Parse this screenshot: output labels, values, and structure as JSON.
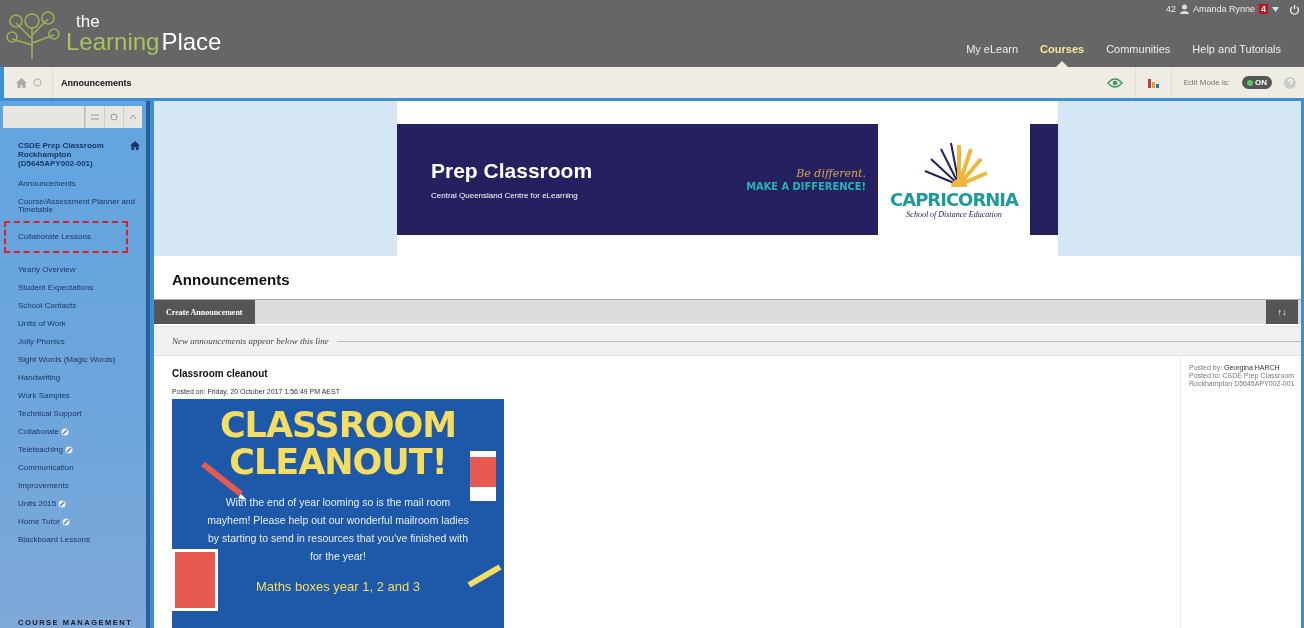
{
  "header": {
    "logo_small": "the",
    "logo_word_1": "Learning",
    "logo_word_2": "Place",
    "user": {
      "count": "42",
      "name": "Amanda Rynne",
      "badge": "4"
    },
    "nav": [
      {
        "label": "My eLearn",
        "selected": false
      },
      {
        "label": "Courses",
        "selected": true
      },
      {
        "label": "Communities",
        "selected": false
      },
      {
        "label": "Help and Tutorials",
        "selected": false
      }
    ]
  },
  "breadcrumb": {
    "current": "Announcements",
    "edit_mode": {
      "label": "Edit Mode is:",
      "state": "ON",
      "on": true
    }
  },
  "sidebar": {
    "course_title": "CSDE Prep Classroom Rockhampton (D5645APY002-001)",
    "items": [
      {
        "label": "Announcements",
        "link_icon": false,
        "highlighted": false
      },
      {
        "label": "Course/Assessment Planner and Timetable",
        "link_icon": false,
        "highlighted": false
      },
      {
        "label": "Collaborate Lessons",
        "link_icon": false,
        "highlighted": true
      },
      {
        "label": "Yearly Overview",
        "link_icon": false,
        "highlighted": false
      },
      {
        "label": "Student Expectations",
        "link_icon": false,
        "highlighted": false
      },
      {
        "label": "School Contacts",
        "link_icon": false,
        "highlighted": false
      },
      {
        "label": "Units of Work",
        "link_icon": false,
        "highlighted": false
      },
      {
        "label": "Jolly Phonics",
        "link_icon": false,
        "highlighted": false
      },
      {
        "label": "Sight Words (Magic Words)",
        "link_icon": false,
        "highlighted": false
      },
      {
        "label": "Handwriting",
        "link_icon": false,
        "highlighted": false
      },
      {
        "label": "Work Samples",
        "link_icon": false,
        "highlighted": false
      },
      {
        "label": "Technical Support",
        "link_icon": false,
        "highlighted": false
      },
      {
        "label": "Collaborate",
        "link_icon": true,
        "highlighted": false
      },
      {
        "label": "Teleteaching",
        "link_icon": true,
        "highlighted": false
      },
      {
        "label": "Communication",
        "link_icon": false,
        "highlighted": false
      },
      {
        "label": "Improvements",
        "link_icon": false,
        "highlighted": false
      },
      {
        "label": "Units 2015",
        "link_icon": true,
        "highlighted": false
      },
      {
        "label": "Home Tutor",
        "link_icon": true,
        "highlighted": false
      },
      {
        "label": "Blackboard Lessons",
        "link_icon": false,
        "highlighted": false
      }
    ],
    "section": "COURSE MANAGEMENT"
  },
  "banner": {
    "title": "Prep Classroom",
    "subtitle": "Central Queensland Centre for eLearning",
    "slogan_1": "Be different.",
    "slogan_2": "MAKE A DIFFERENCE!",
    "school": "CAPRICORNIA",
    "school_tagline": "School of Distance Education"
  },
  "page_title": "Announcements",
  "actions": {
    "create": "Create Announcement",
    "sort": "↑↓"
  },
  "divider_note": "New announcements appear below this line",
  "announcement": {
    "title": "Classroom cleanout",
    "posted_on": "Posted on: Friday, 20 October 2017 1:56:49 PM AEST",
    "posted_by": "Posted by: **Georgina HARCH**",
    "posted_to": "Posted to: CSDE Prep Classroom Rockhampton D5645APY002-001",
    "flyer": {
      "heading_1": "CLASSROOM",
      "heading_2": "CLEANOUT!",
      "body": "With the end of year looming so is the mail room mayhem! Please help out our wonderful mailroom ladies by starting to send in resources that you've finished with for the year!",
      "footer": "Maths boxes year 1, 2 and 3"
    }
  }
}
